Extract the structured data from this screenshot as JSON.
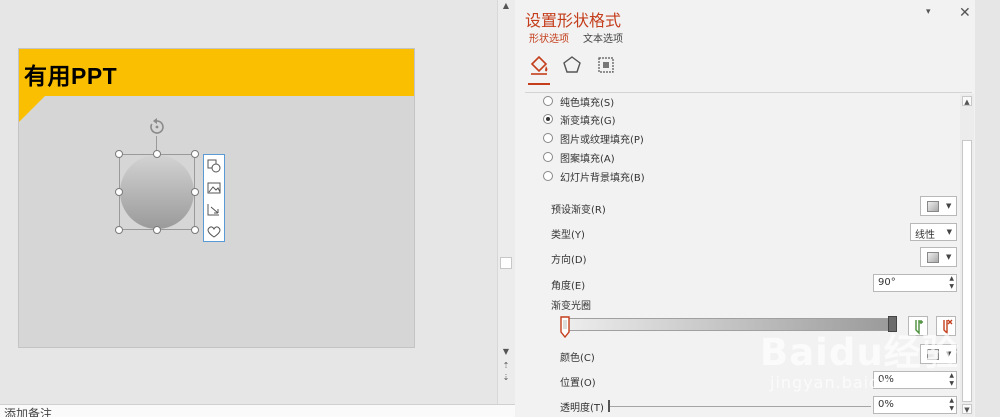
{
  "slide": {
    "title": "有用PPT",
    "banner_color": "#f9bf00",
    "shape_gradient": [
      "#d3d3d3",
      "#9a9a9a"
    ]
  },
  "quick_tools": [
    "shape-styles-icon",
    "picture-icon",
    "crop-icon",
    "heart-icon"
  ],
  "notes_placeholder": "添加备注",
  "pane": {
    "title": "设置形状格式",
    "accent_color": "#c43e1c",
    "menu_icon": "▾",
    "close_icon": "✕",
    "tabs": {
      "shape_options": "形状选项",
      "text_options": "文本选项"
    },
    "icons": [
      "fill-line-icon",
      "effects-icon",
      "size-properties-icon"
    ],
    "fill_options": [
      {
        "label": "纯色填充(S)",
        "selected": false
      },
      {
        "label": "渐变填充(G)",
        "selected": true
      },
      {
        "label": "图片或纹理填充(P)",
        "selected": false
      },
      {
        "label": "图案填充(A)",
        "selected": false
      },
      {
        "label": "幻灯片背景填充(B)",
        "selected": false
      }
    ],
    "preset_gradient_label": "预设渐变(R)",
    "type_label": "类型(Y)",
    "type_value": "线性",
    "direction_label": "方向(D)",
    "angle_label": "角度(E)",
    "angle_value": "90°",
    "gradient_stops_label": "渐变光圈",
    "color_label": "颜色(C)",
    "position_label": "位置(O)",
    "position_value": "0%",
    "transparency_label": "透明度(T)",
    "transparency_value": "0%"
  },
  "watermark": {
    "logo": "Baidu经验",
    "url": "jingyan.baidu.com"
  }
}
